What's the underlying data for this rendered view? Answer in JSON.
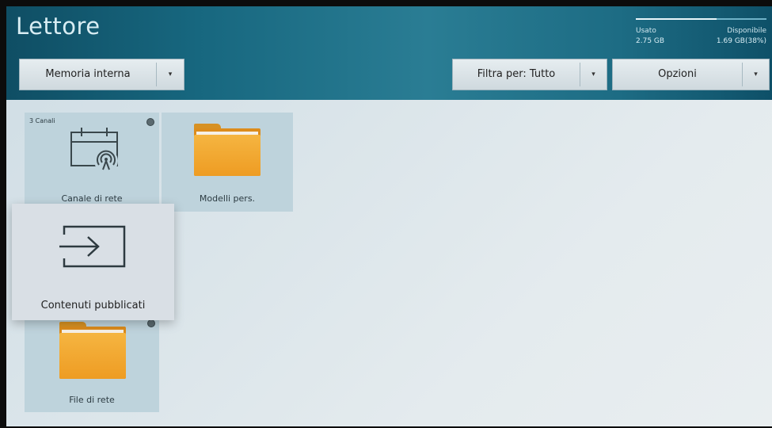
{
  "header": {
    "title": "Lettore",
    "storage": {
      "used_label": "Usato",
      "used_value": "2.75 GB",
      "available_label": "Disponibile",
      "available_value": "1.69 GB(38%)",
      "used_fraction": 0.62
    }
  },
  "toolbar": {
    "storage_dropdown": "Memoria interna",
    "filter_dropdown": "Filtra per: Tutto",
    "options_dropdown": "Opzioni",
    "arrow_glyph": "▾"
  },
  "tiles": [
    {
      "label": "Canale di rete",
      "badge": "3 Canali",
      "icon": "network-channel-icon"
    },
    {
      "label": "Modelli pers.",
      "icon": "folder-icon"
    },
    {
      "label": "File di rete",
      "icon": "folder-icon"
    }
  ],
  "focused_tile": {
    "label": "Contenuti pubblicati",
    "icon": "import-arrow-icon"
  },
  "colors": {
    "header_bg": "#17677f",
    "content_bg": "#dbe5ea",
    "tile_bg": "#bed3dc",
    "folder": "#f0a52c"
  }
}
